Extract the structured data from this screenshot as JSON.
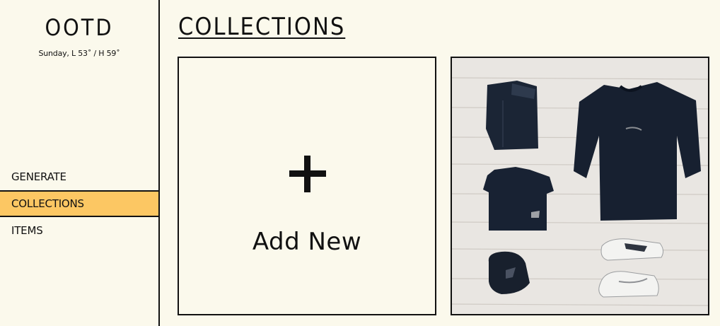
{
  "sidebar": {
    "app_title": "OOTD",
    "weather": "Sunday, L 53˚ / H 59˚",
    "nav": [
      {
        "label": "GENERATE",
        "active": false
      },
      {
        "label": "COLLECTIONS",
        "active": true
      },
      {
        "label": "ITEMS",
        "active": false
      }
    ]
  },
  "main": {
    "title": "COLLECTIONS",
    "add_card": {
      "label": "Add New",
      "icon": "plus-icon"
    },
    "collections": [
      {
        "image": "outfit-photo",
        "description_icon": "flat-lay-outfit"
      }
    ]
  },
  "colors": {
    "background": "#fbf9ec",
    "active_nav": "#fcc763",
    "border": "#111111",
    "floor": "#e7e4e0",
    "clothing": "#1a2330"
  }
}
